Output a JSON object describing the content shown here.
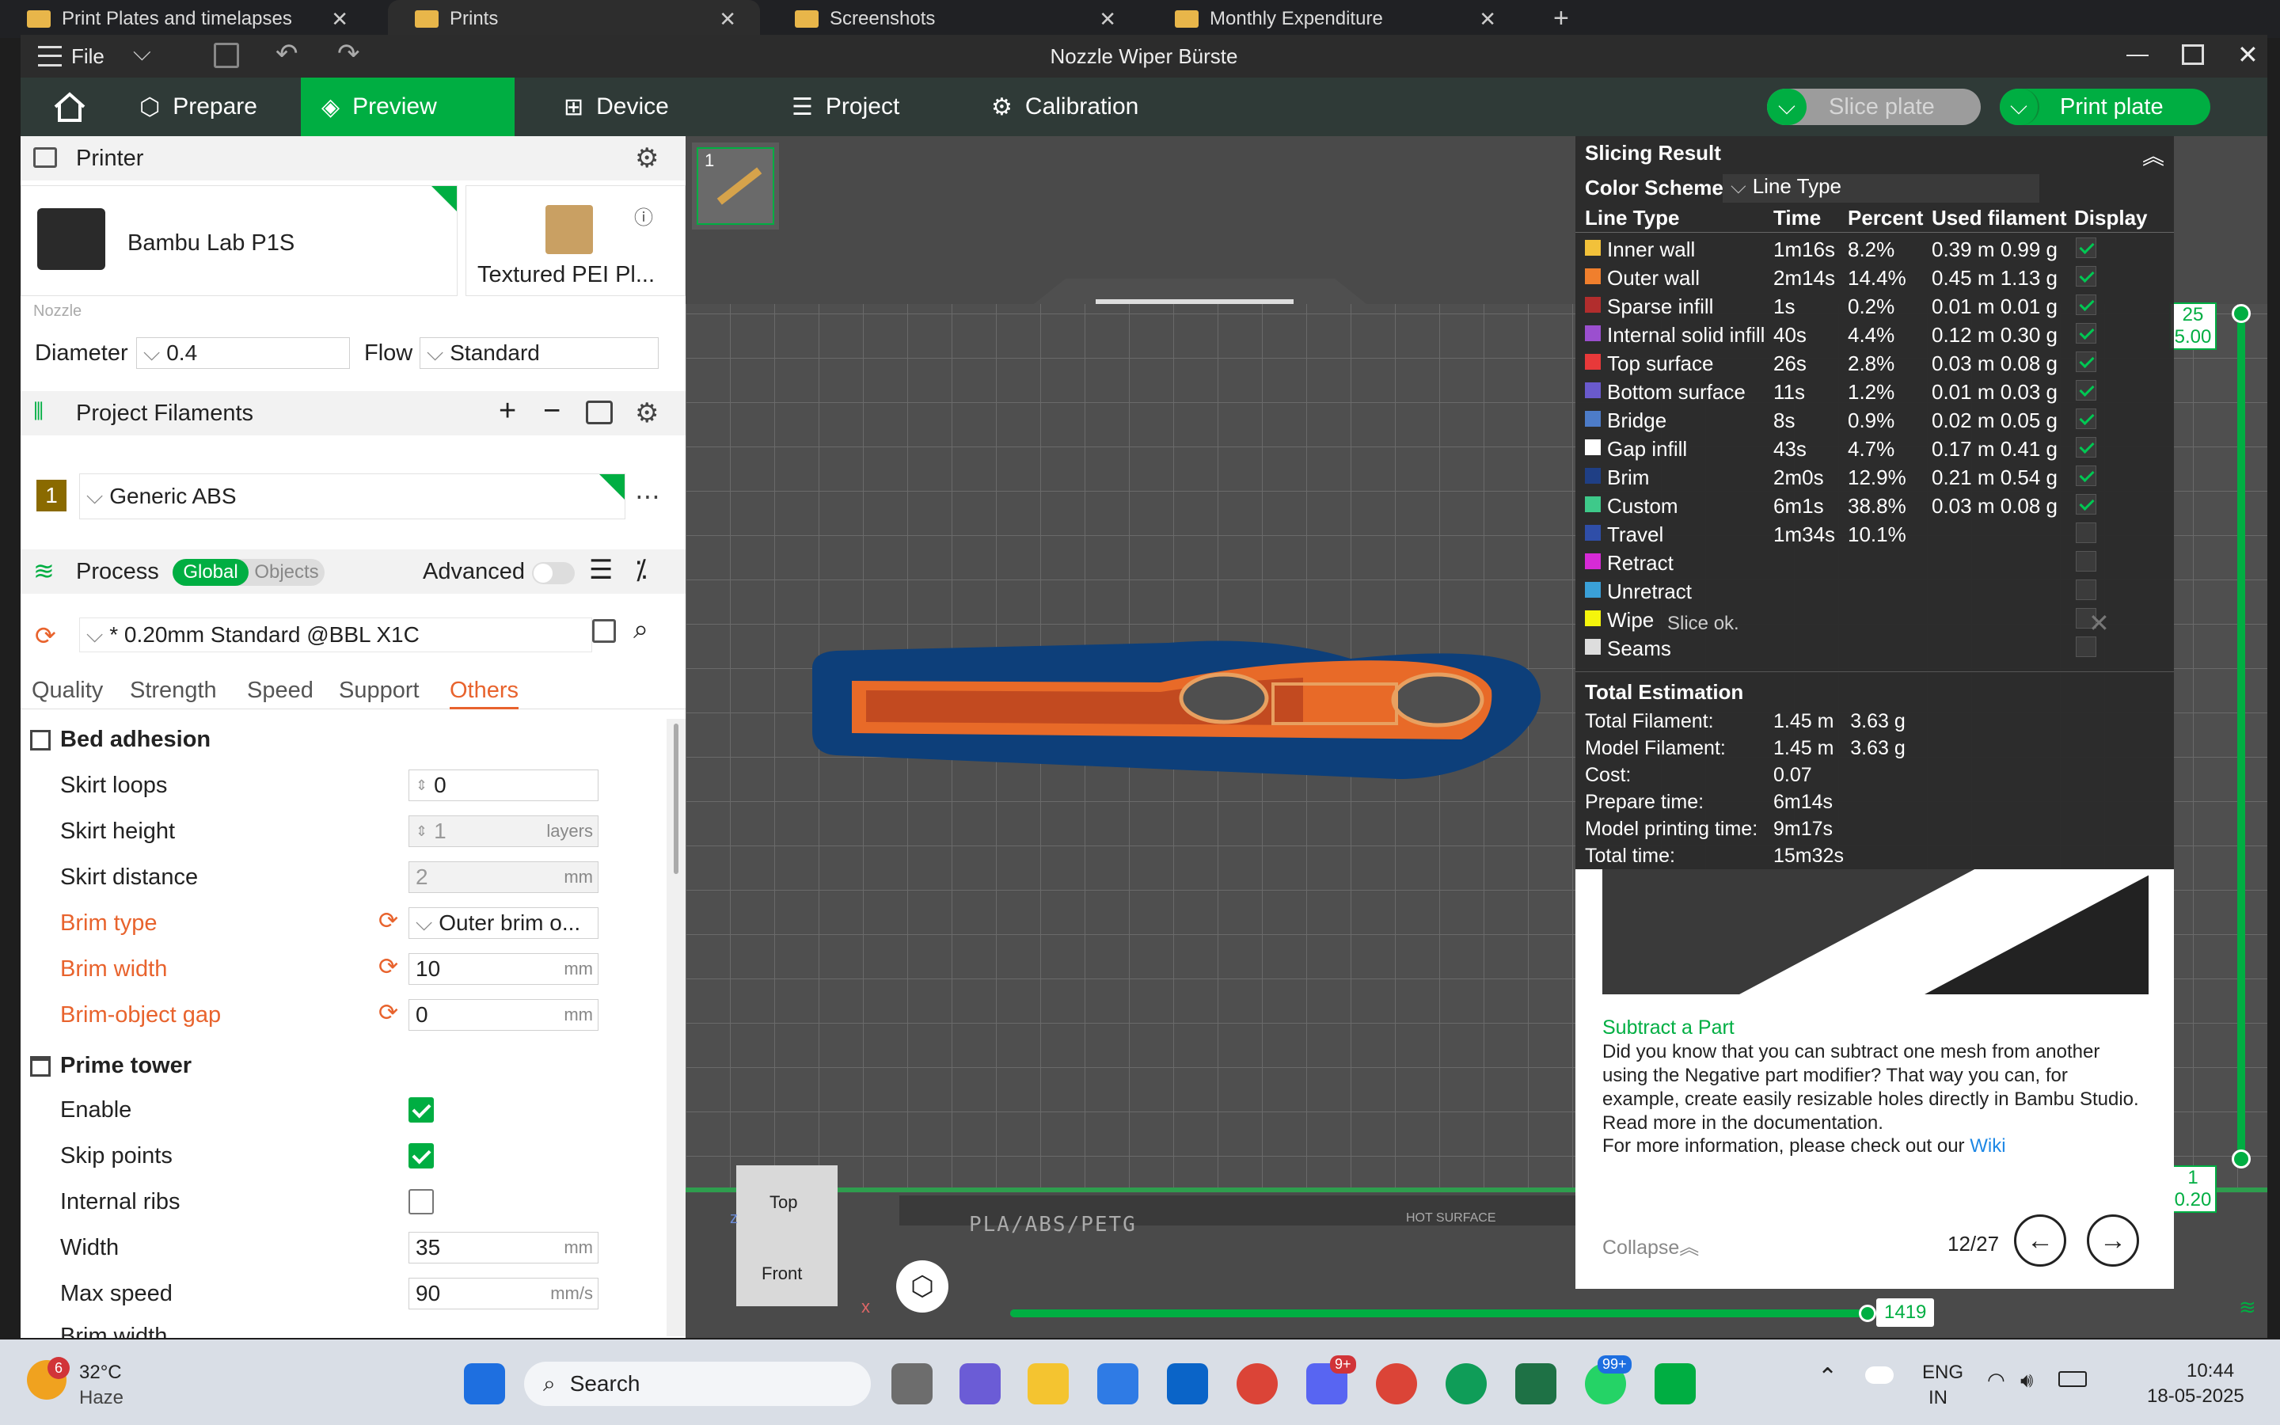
{
  "tabs": [
    {
      "label": "Print Plates and timelapses"
    },
    {
      "label": "Prints"
    },
    {
      "label": "Screenshots"
    },
    {
      "label": "Monthly Expenditure"
    }
  ],
  "app": {
    "title": "Nozzle Wiper Bürste",
    "file_menu": "File"
  },
  "nav": {
    "prepare": "Prepare",
    "preview": "Preview",
    "device": "Device",
    "project": "Project",
    "calibration": "Calibration",
    "slice_plate": "Slice plate",
    "print_plate": "Print plate"
  },
  "printer": {
    "header": "Printer",
    "name": "Bambu Lab P1S",
    "plate": "Textured PEI Pl...",
    "nozzle_label": "Nozzle",
    "diameter_label": "Diameter",
    "diameter_value": "0.4",
    "flow_label": "Flow",
    "flow_value": "Standard"
  },
  "filaments": {
    "header": "Project Filaments",
    "index": "1",
    "name": "Generic ABS"
  },
  "process": {
    "header": "Process",
    "toggle_global": "Global",
    "toggle_objects": "Objects",
    "advanced": "Advanced",
    "preset": "* 0.20mm Standard @BBL X1C",
    "tabs": [
      "Quality",
      "Strength",
      "Speed",
      "Support",
      "Others"
    ]
  },
  "bed_adhesion": {
    "header": "Bed adhesion",
    "skirt_loops_label": "Skirt loops",
    "skirt_loops": "0",
    "skirt_height_label": "Skirt height",
    "skirt_height": "1",
    "skirt_height_unit": "layers",
    "skirt_distance_label": "Skirt distance",
    "skirt_distance": "2",
    "mm": "mm",
    "brim_type_label": "Brim type",
    "brim_type": "Outer brim o...",
    "brim_width_label": "Brim width",
    "brim_width": "10",
    "brim_gap_label": "Brim-object gap",
    "brim_gap": "0"
  },
  "prime_tower": {
    "header": "Prime tower",
    "enable_label": "Enable",
    "enable": true,
    "skip_points_label": "Skip points",
    "skip_points": true,
    "internal_ribs_label": "Internal ribs",
    "internal_ribs": false,
    "width_label": "Width",
    "width": "35",
    "max_speed_label": "Max speed",
    "max_speed": "90",
    "mm_s": "mm/s",
    "brim_width_label": "Brim width"
  },
  "viewport": {
    "plate_number": "1",
    "bed_label": "PLA/ABS/PETG",
    "hot_surface": "HOT SURFACE",
    "view_top": "Top",
    "view_front": "Front",
    "axis_x": "x",
    "axis_z": "z",
    "layer_top": "25",
    "layer_top_height": "5.00",
    "layer_bottom": "1",
    "layer_bottom_height": "0.20",
    "move_value": "1419",
    "move_fraction": 0.995,
    "layer_fraction": 1.0
  },
  "slicing": {
    "header": "Slicing Result",
    "color_scheme_label": "Color Scheme",
    "color_scheme": "Line Type",
    "columns": [
      "Line Type",
      "Time",
      "Percent",
      "Used filament",
      "Display"
    ],
    "rows": [
      {
        "name": "Inner wall",
        "color": "#f2c13a",
        "time": "1m16s",
        "percent": "8.2%",
        "used": "0.39 m 0.99 g",
        "display": true
      },
      {
        "name": "Outer wall",
        "color": "#f07f2d",
        "time": "2m14s",
        "percent": "14.4%",
        "used": "0.45 m 1.13 g",
        "display": true
      },
      {
        "name": "Sparse infill",
        "color": "#b22d2d",
        "time": "1s",
        "percent": "0.2%",
        "used": "0.01 m 0.01 g",
        "display": true
      },
      {
        "name": "Internal solid infill",
        "color": "#9b4fcf",
        "time": "40s",
        "percent": "4.4%",
        "used": "0.12 m 0.30 g",
        "display": true
      },
      {
        "name": "Top surface",
        "color": "#e8393a",
        "time": "26s",
        "percent": "2.8%",
        "used": "0.03 m 0.08 g",
        "display": true
      },
      {
        "name": "Bottom surface",
        "color": "#6a5acd",
        "time": "11s",
        "percent": "1.2%",
        "used": "0.01 m 0.03 g",
        "display": true
      },
      {
        "name": "Bridge",
        "color": "#4d7cc9",
        "time": "8s",
        "percent": "0.9%",
        "used": "0.02 m 0.05 g",
        "display": true
      },
      {
        "name": "Gap infill",
        "color": "#ffffff",
        "time": "43s",
        "percent": "4.7%",
        "used": "0.17 m 0.41 g",
        "display": true
      },
      {
        "name": "Brim",
        "color": "#1f3f85",
        "time": "2m0s",
        "percent": "12.9%",
        "used": "0.21 m 0.54 g",
        "display": true
      },
      {
        "name": "Custom",
        "color": "#3ec98a",
        "time": "6m1s",
        "percent": "38.8%",
        "used": "0.03 m 0.08 g",
        "display": true
      },
      {
        "name": "Travel",
        "color": "#2f4ea8",
        "time": "1m34s",
        "percent": "10.1%",
        "used": "",
        "display": false
      },
      {
        "name": "Retract",
        "color": "#d62ad6",
        "time": "",
        "percent": "",
        "used": "",
        "display": false
      },
      {
        "name": "Unretract",
        "color": "#3aa0d8",
        "time": "",
        "percent": "",
        "used": "",
        "display": false
      },
      {
        "name": "Wipe",
        "color": "#f5f50c",
        "time": "",
        "percent": "",
        "used": "",
        "display": false
      },
      {
        "name": "Seams",
        "color": "#dddddd",
        "time": "",
        "percent": "",
        "used": "",
        "display": false
      }
    ],
    "slice_ok": "Slice ok.",
    "total_header": "Total Estimation",
    "total_filament_label": "Total Filament:",
    "total_filament": "1.45 m   3.63 g",
    "model_filament_label": "Model Filament:",
    "model_filament": "1.45 m   3.63 g",
    "cost_label": "Cost:",
    "cost": "0.07",
    "prepare_time_label": "Prepare time:",
    "prepare_time": "6m14s",
    "model_time_label": "Model printing time:",
    "model_time": "9m17s",
    "total_time_label": "Total time:",
    "total_time": "15m32s"
  },
  "tip": {
    "title": "Subtract a Part",
    "body": "Did you know that you can subtract one mesh from another using the Negative part modifier? That way you can, for example, create easily resizable holes directly in Bambu Studio. Read more in the documentation.",
    "more": "For more information, please check out our",
    "wiki": "Wiki",
    "collapse": "Collapse",
    "page": "12/27"
  },
  "taskbar": {
    "weather_temp": "32°C",
    "weather_desc": "Haze",
    "weather_badge": "6",
    "search": "Search",
    "lang1": "ENG",
    "lang2": "IN",
    "time": "10:44",
    "date": "18-05-2025",
    "badge_discord": "9+",
    "badge_whatsapp": "99+"
  }
}
